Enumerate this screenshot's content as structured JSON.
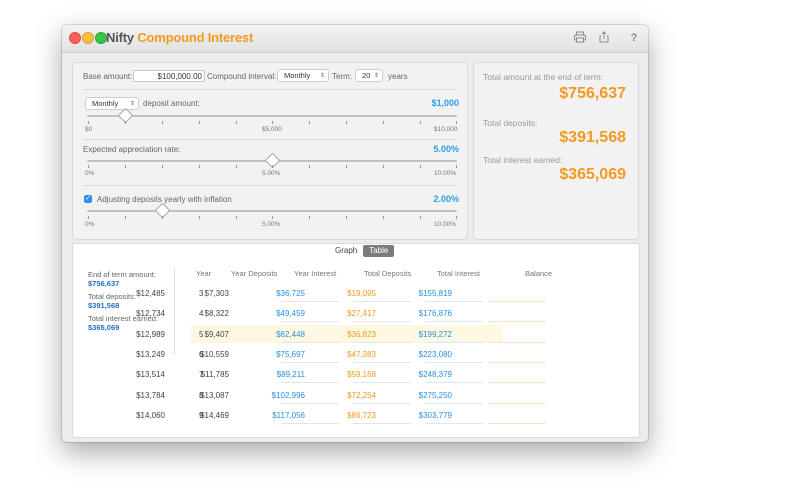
{
  "app": {
    "title_part1": "Nifty",
    "title_part2": "Compound Interest",
    "toolbar": [
      "print-icon",
      "share-icon",
      "help-icon"
    ],
    "help_glyph": "?"
  },
  "inputs": {
    "base_amount_label": "Base amount:",
    "base_amount_value": "$100,000.00",
    "compound_interval_label": "Compound interval:",
    "compound_interval_value": "Monthly",
    "term_label": "Term:",
    "term_value": "20",
    "term_unit": "years"
  },
  "deposit": {
    "frequency": "Monthly",
    "label": "deposit amount:",
    "value": "$1,000",
    "ticks": [
      "$0",
      "$5,000",
      "$10,000"
    ]
  },
  "appreciation": {
    "label": "Expected appreciation rate:",
    "value": "5.00%",
    "ticks": [
      "0%",
      "5.00%",
      "10.00%"
    ]
  },
  "inflation": {
    "checked": true,
    "label": "Adjusting deposits yearly with inflation",
    "value": "2.00%",
    "ticks": [
      "0%",
      "5.00%",
      "10.00%"
    ]
  },
  "results": {
    "total_end_label": "Total amount at the end of term:",
    "total_end_value": "$756,637",
    "deposits_label": "Total deposits:",
    "deposits_value": "$391,568",
    "interest_label": "Total interest earned:",
    "interest_value": "$365,069"
  },
  "view": {
    "tabs": [
      "Graph",
      "Table"
    ],
    "selected": "Table"
  },
  "summary": {
    "end_label": "End of term amount:",
    "end_value": "$756,637",
    "deposits_label": "Total deposits:",
    "deposits_value": "$391,568",
    "interest_label": "Total interest earned:",
    "interest_value": "$365,069"
  },
  "table": {
    "headers": [
      "Year",
      "Year Deposits",
      "Year Interest",
      "Total Deposits",
      "Total Interest",
      "Balance"
    ],
    "highlighted_row": 2,
    "rows": [
      [
        "3",
        "$12,485",
        "$7,303",
        "$36,725",
        "$19,095",
        "$155,819"
      ],
      [
        "4",
        "$12,734",
        "$8,322",
        "$49,459",
        "$27,417",
        "$176,876"
      ],
      [
        "5",
        "$12,989",
        "$9,407",
        "$62,448",
        "$36,823",
        "$199,272"
      ],
      [
        "6",
        "$13,249",
        "$10,559",
        "$75,697",
        "$47,383",
        "$223,080"
      ],
      [
        "7",
        "$13,514",
        "$11,785",
        "$89,211",
        "$59,168",
        "$248,379"
      ],
      [
        "8",
        "$13,784",
        "$13,087",
        "$102,996",
        "$72,254",
        "$275,250"
      ],
      [
        "9",
        "$14,060",
        "$14,469",
        "$117,056",
        "$86,723",
        "$303,779"
      ]
    ]
  },
  "colors": {
    "accent_orange": "#f39a1f",
    "accent_blue": "#2b9de8"
  }
}
